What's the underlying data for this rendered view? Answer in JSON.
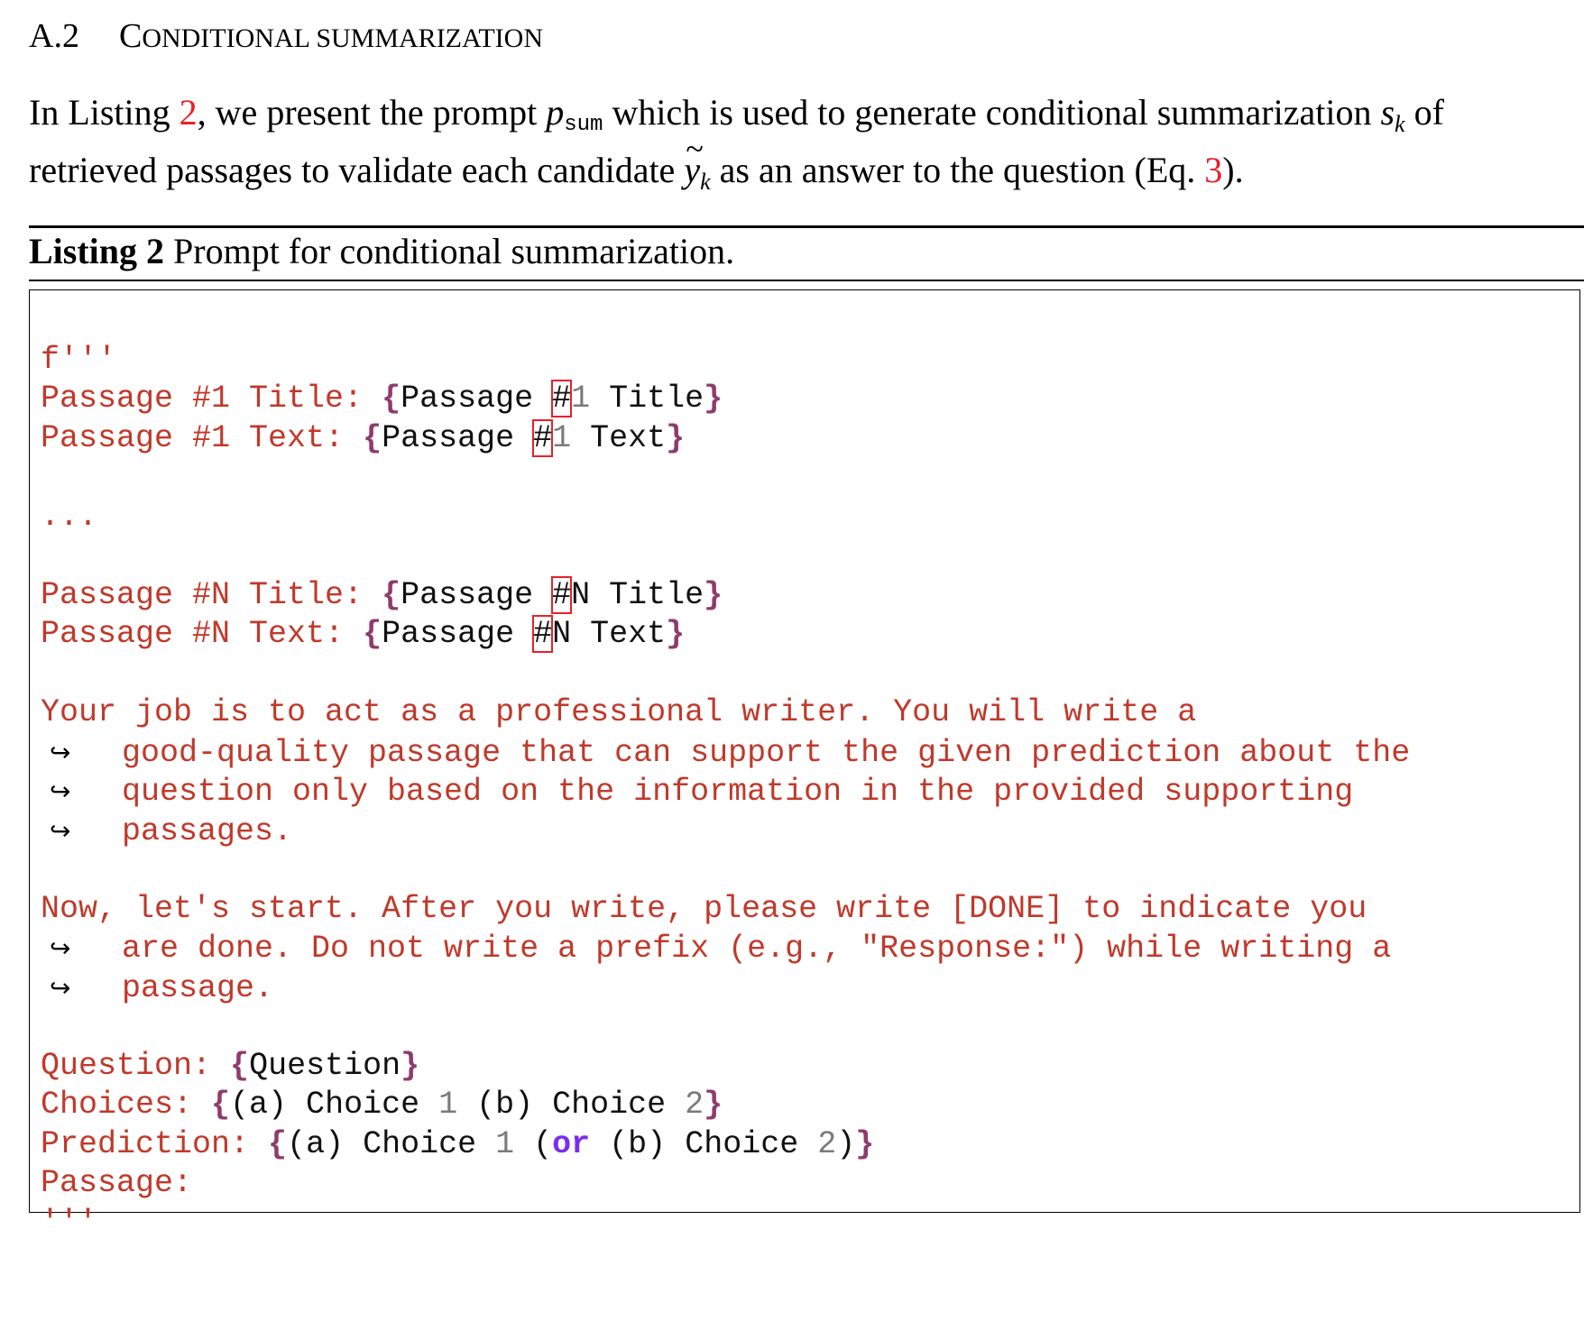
{
  "section": {
    "number": "A.2",
    "title_first_big": "C",
    "title_rest": "ONDITIONAL SUMMARIZATION"
  },
  "intro": {
    "l1_a": "In Listing ",
    "l1_ref": "2",
    "l1_b": ", we present the prompt ",
    "l1_p": "p",
    "l1_p_sub": "sum",
    "l1_c": " which is used to generate conditional summarization ",
    "l1_s": "s",
    "l1_s_sub": "k",
    "l1_d": " of",
    "l2_a": "retrieved passages to validate each candidate ",
    "l2_y": "y",
    "l2_y_sub": "k",
    "l2_b": " as an answer to the question (Eq. ",
    "l2_ref": "3",
    "l2_c": ")."
  },
  "listing": {
    "label": "Listing 2",
    "caption": " Prompt for conditional summarization."
  },
  "code": {
    "f_open": "f'''",
    "p1_title_key": "Passage #1 Title: ",
    "p1_text_key": "Passage #1 Text: ",
    "passage_word": "Passage ",
    "hash": "#",
    "one": "1",
    "title_word": " Title",
    "text_word": " Text",
    "brace_open": "{",
    "brace_close": "}",
    "ellipsis": "...",
    "pn_title_key": "Passage #N Title: ",
    "pn_text_key": "Passage #N Text: ",
    "n": "N",
    "para1_l1": "Your job is to act as a professional writer. You will write a",
    "para1_l2": "good-quality passage that can support the given prediction about the",
    "para1_l3": "question only based on the information in the provided supporting",
    "para1_l4": "passages.",
    "para2_l1": "Now, let's start. After you write, please write [DONE] to indicate you",
    "para2_l2": "are done. Do not write a prefix (e.g., \"Response:\") while writing a",
    "para2_l3": "passage.",
    "cont_arrow": "↪",
    "question_key": "Question: ",
    "question_val": "Question",
    "choices_key": "Choices: ",
    "choice_a": "(a) Choice ",
    "choice_b": " (b) Choice ",
    "two": "2",
    "prediction_key": "Prediction: ",
    "paren_open": "(",
    "or_kw": "or",
    "pred_b": " (b) Choice ",
    "paren_close": ")",
    "passage_key": "Passage:",
    "f_close": "'''"
  }
}
